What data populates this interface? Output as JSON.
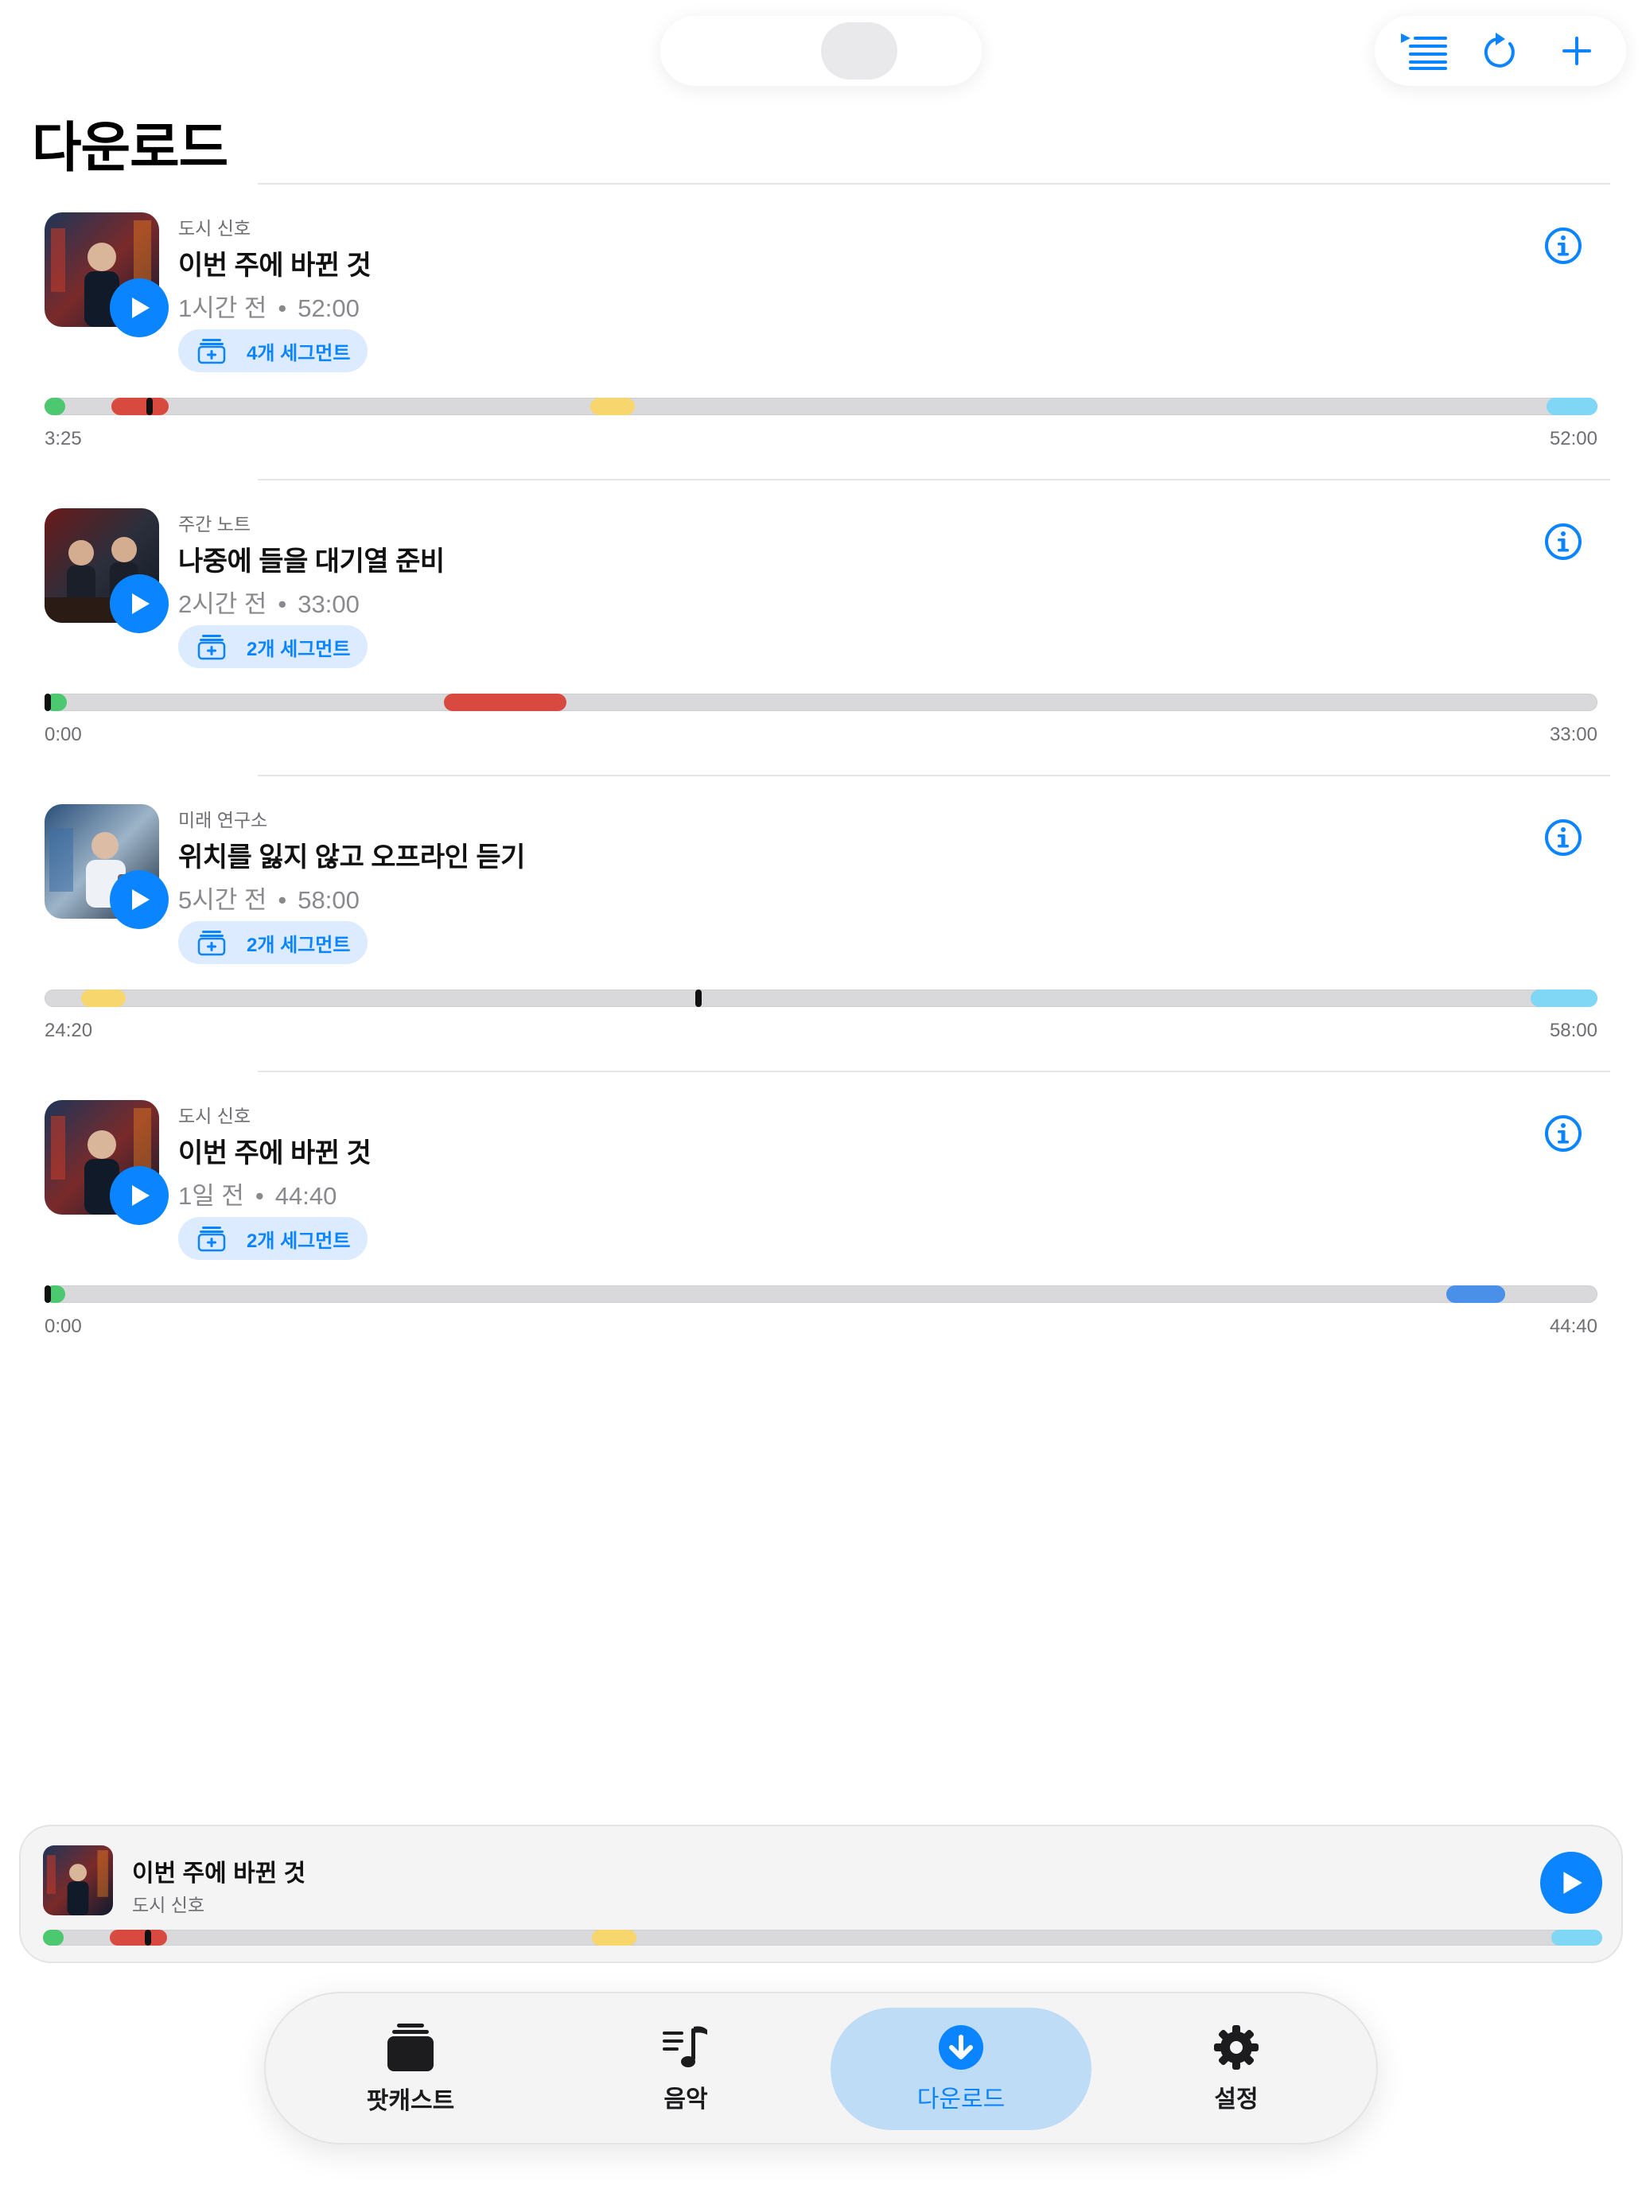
{
  "page": {
    "title": "다운로드"
  },
  "colors": {
    "accent": "#0a84ff",
    "segment_green": "#4cc870",
    "segment_red": "#d84a3f",
    "segment_yellow": "#f7d66e",
    "segment_cyan": "#7fd6f5",
    "segment_blue": "#4a90e8"
  },
  "toolbar": {
    "icons": [
      "play-queue-icon",
      "refresh-icon",
      "add-icon"
    ]
  },
  "episodes": [
    {
      "show": "도시 신호",
      "title": "이번 주에 바뀐 것",
      "age": "1시간 전",
      "duration": "52:00",
      "segments_label": "4개 세그먼트",
      "start_time": "3:25",
      "end_time": "52:00"
    },
    {
      "show": "주간 노트",
      "title": "나중에 들을 대기열 준비",
      "age": "2시간 전",
      "duration": "33:00",
      "segments_label": "2개 세그먼트",
      "start_time": "0:00",
      "end_time": "33:00"
    },
    {
      "show": "미래 연구소",
      "title": "위치를 잃지 않고 오프라인 듣기",
      "age": "5시간 전",
      "duration": "58:00",
      "segments_label": "2개 세그먼트",
      "start_time": "24:20",
      "end_time": "58:00"
    },
    {
      "show": "도시 신호",
      "title": "이번 주에 바뀐 것",
      "age": "1일 전",
      "duration": "44:40",
      "segments_label": "2개 세그먼트",
      "start_time": "0:00",
      "end_time": "44:40"
    }
  ],
  "now_playing": {
    "title": "이번 주에 바뀐 것",
    "show": "도시 신호"
  },
  "tabs": [
    {
      "label": "팟캐스트",
      "icon": "podcast-stack-icon",
      "active": false
    },
    {
      "label": "음악",
      "icon": "music-note-list-icon",
      "active": false
    },
    {
      "label": "다운로드",
      "icon": "download-circle-icon",
      "active": true
    },
    {
      "label": "설정",
      "icon": "gear-icon",
      "active": false
    }
  ]
}
